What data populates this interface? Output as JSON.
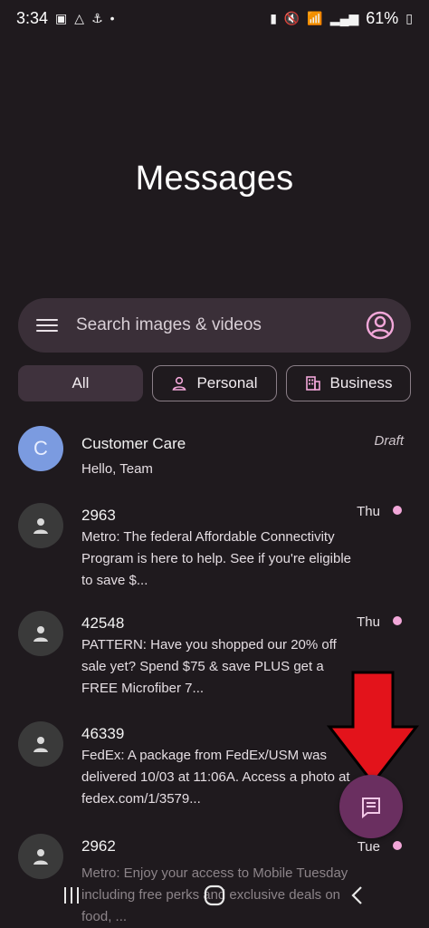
{
  "status": {
    "time": "3:34",
    "battery": "61%"
  },
  "header": {
    "title": "Messages"
  },
  "search": {
    "placeholder": "Search images & videos"
  },
  "filters": [
    {
      "label": "All",
      "selected": true
    },
    {
      "label": "Personal",
      "selected": false
    },
    {
      "label": "Business",
      "selected": false
    }
  ],
  "conversations": [
    {
      "avatar_letter": "C",
      "name": "Customer Care",
      "snippet": "Hello, Team",
      "time": "Draft",
      "unread": false
    },
    {
      "avatar_letter": "",
      "name": "2963",
      "snippet": "Metro: The federal Affordable Connectivity Program is here to help. See if you're eligible to save $...",
      "time": "Thu",
      "unread": true
    },
    {
      "avatar_letter": "",
      "name": "42548",
      "snippet": "PATTERN: Have you shopped our 20% off sale yet? Spend $75 & save PLUS get a FREE Microfiber 7...",
      "time": "Thu",
      "unread": true
    },
    {
      "avatar_letter": "",
      "name": "46339",
      "snippet": "FedEx: A package from FedEx/USM was delivered 10/03 at 11:06A. Access a photo at fedex.com/1/3579...",
      "time": "",
      "unread": false
    },
    {
      "avatar_letter": "",
      "name": "2962",
      "snippet": "Metro: Enjoy your access to Mobile Tuesday including free perks and exclusive deals on food, ...",
      "time": "Tue",
      "unread": true
    }
  ],
  "colors": {
    "background": "#1f1a1e",
    "accent_pink": "#f2a7d9",
    "fab": "#6a2f60",
    "arrow": "#e3131b"
  }
}
